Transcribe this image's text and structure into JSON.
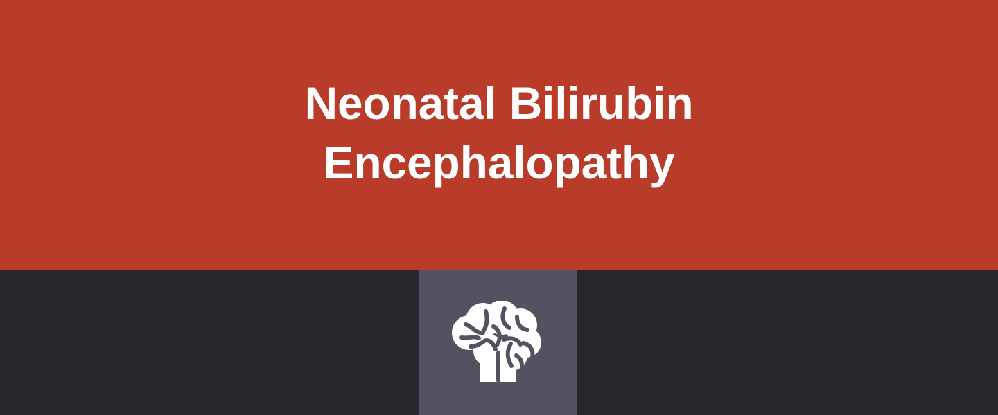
{
  "header": {
    "title_line_1": "Neonatal Bilirubin",
    "title_line_2": "Encephalopathy"
  },
  "icon": {
    "name": "brain-icon"
  },
  "colors": {
    "header_background": "#b93b29",
    "bottom_background": "#28272d",
    "icon_tile_background": "#525260",
    "foreground": "#ffffff",
    "icon_detail": "#525260"
  }
}
